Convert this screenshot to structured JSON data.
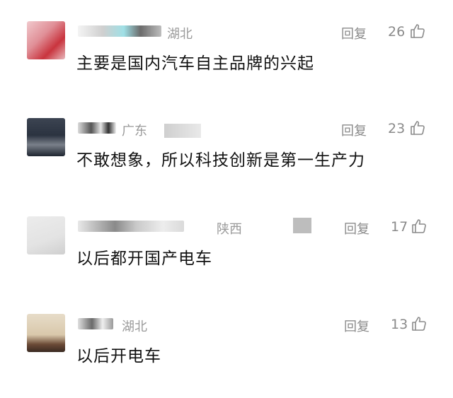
{
  "colors": {
    "meta": "#9a9a9a",
    "text": "#111111",
    "background": "#ffffff"
  },
  "comments": [
    {
      "region": "湖北",
      "reply": "回复",
      "likes": "26",
      "text": "主要是国内汽车自主品牌的兴起",
      "icon": "thumbs-up-icon"
    },
    {
      "region": "广东",
      "reply": "回复",
      "likes": "23",
      "text": "不敢想象，所以科技创新是第一生产力",
      "icon": "thumbs-up-icon"
    },
    {
      "region": "陕西",
      "reply": "回复",
      "likes": "17",
      "text": "以后都开国产电车",
      "icon": "thumbs-up-icon"
    },
    {
      "region": "湖北",
      "reply": "回复",
      "likes": "13",
      "text": "以后开电车",
      "icon": "thumbs-up-icon"
    }
  ]
}
